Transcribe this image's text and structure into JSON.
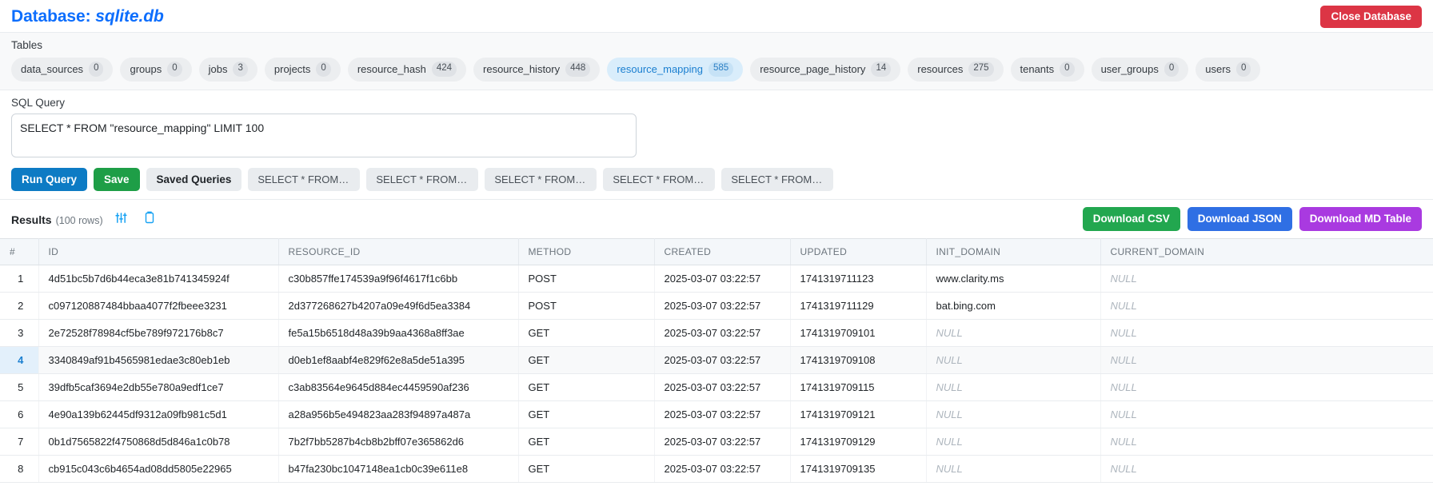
{
  "header": {
    "title_prefix": "Database:",
    "db_name": "sqlite.db",
    "close_button": "Close Database"
  },
  "tables_panel": {
    "label": "Tables",
    "tables": [
      {
        "name": "data_sources",
        "count": "0",
        "active": false
      },
      {
        "name": "groups",
        "count": "0",
        "active": false
      },
      {
        "name": "jobs",
        "count": "3",
        "active": false
      },
      {
        "name": "projects",
        "count": "0",
        "active": false
      },
      {
        "name": "resource_hash",
        "count": "424",
        "active": false
      },
      {
        "name": "resource_history",
        "count": "448",
        "active": false
      },
      {
        "name": "resource_mapping",
        "count": "585",
        "active": true
      },
      {
        "name": "resource_page_history",
        "count": "14",
        "active": false
      },
      {
        "name": "resources",
        "count": "275",
        "active": false
      },
      {
        "name": "tenants",
        "count": "0",
        "active": false
      },
      {
        "name": "user_groups",
        "count": "0",
        "active": false
      },
      {
        "name": "users",
        "count": "0",
        "active": false
      }
    ]
  },
  "sql": {
    "label": "SQL Query",
    "value": "SELECT * FROM \"resource_mapping\" LIMIT 100",
    "placeholder": "SELECT * FROM \"resource_mapping\" LIMIT 100"
  },
  "actions": {
    "run_query": "Run Query",
    "save": "Save",
    "saved_queries": "Saved Queries",
    "recent": [
      "SELECT * FROM \"resou...",
      "SELECT * FROM \"resou...",
      "SELECT * FROM \"resou...",
      "SELECT * FROM \"netwo...",
      "SELECT * FROM \"data_..."
    ]
  },
  "results": {
    "title": "Results",
    "count_label": "(100 rows)",
    "filter_icon": "sliders-icon",
    "copy_icon": "clipboard-icon",
    "download_csv": "Download CSV",
    "download_json": "Download JSON",
    "download_md": "Download MD Table",
    "columns": [
      "#",
      "ID",
      "RESOURCE_ID",
      "METHOD",
      "CREATED",
      "UPDATED",
      "INIT_DOMAIN",
      "CURRENT_DOMAIN"
    ],
    "selected_row": 4,
    "rows": [
      {
        "num": "1",
        "id": "4d51bc5b7d6b44eca3e81b741345924f",
        "resource_id": "c30b857ffe174539a9f96f4617f1c6bb",
        "method": "POST",
        "created": "2025-03-07 03:22:57",
        "updated": "1741319711123",
        "init_domain": "www.clarity.ms",
        "current_domain": "NULL"
      },
      {
        "num": "2",
        "id": "c097120887484bbaa4077f2fbeee3231",
        "resource_id": "2d377268627b4207a09e49f6d5ea3384",
        "method": "POST",
        "created": "2025-03-07 03:22:57",
        "updated": "1741319711129",
        "init_domain": "bat.bing.com",
        "current_domain": "NULL"
      },
      {
        "num": "3",
        "id": "2e72528f78984cf5be789f972176b8c7",
        "resource_id": "fe5a15b6518d48a39b9aa4368a8ff3ae",
        "method": "GET",
        "created": "2025-03-07 03:22:57",
        "updated": "1741319709101",
        "init_domain": "NULL",
        "current_domain": "NULL"
      },
      {
        "num": "4",
        "id": "3340849af91b4565981edae3c80eb1eb",
        "resource_id": "d0eb1ef8aabf4e829f62e8a5de51a395",
        "method": "GET",
        "created": "2025-03-07 03:22:57",
        "updated": "1741319709108",
        "init_domain": "NULL",
        "current_domain": "NULL"
      },
      {
        "num": "5",
        "id": "39dfb5caf3694e2db55e780a9edf1ce7",
        "resource_id": "c3ab83564e9645d884ec4459590af236",
        "method": "GET",
        "created": "2025-03-07 03:22:57",
        "updated": "1741319709115",
        "init_domain": "NULL",
        "current_domain": "NULL"
      },
      {
        "num": "6",
        "id": "4e90a139b62445df9312a09fb981c5d1",
        "resource_id": "a28a956b5e494823aa283f94897a487a",
        "method": "GET",
        "created": "2025-03-07 03:22:57",
        "updated": "1741319709121",
        "init_domain": "NULL",
        "current_domain": "NULL"
      },
      {
        "num": "7",
        "id": "0b1d7565822f4750868d5d846a1c0b78",
        "resource_id": "7b2f7bb5287b4cb8b2bff07e365862d6",
        "method": "GET",
        "created": "2025-03-07 03:22:57",
        "updated": "1741319709129",
        "init_domain": "NULL",
        "current_domain": "NULL"
      },
      {
        "num": "8",
        "id": "cb915c043c6b4654ad08dd5805e22965",
        "resource_id": "b47fa230bc1047148ea1cb0c39e611e8",
        "method": "GET",
        "created": "2025-03-07 03:22:57",
        "updated": "1741319709135",
        "init_domain": "NULL",
        "current_domain": "NULL"
      }
    ]
  },
  "colors": {
    "accent_blue": "#0d6efd",
    "danger_red": "#dc3545",
    "success_green": "#1e9e47",
    "csv_green": "#22a74f",
    "json_blue": "#2f6fe4",
    "md_purple": "#a93ae0"
  }
}
